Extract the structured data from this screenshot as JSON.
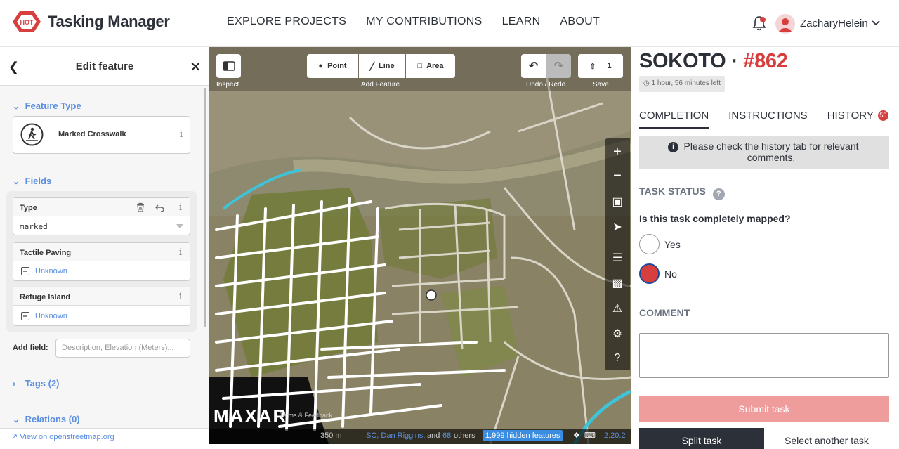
{
  "header": {
    "brand": "Tasking Manager",
    "logo_text": "HOT",
    "nav": [
      "EXPLORE PROJECTS",
      "MY CONTRIBUTIONS",
      "LEARN",
      "ABOUT"
    ],
    "username": "ZacharyHelein"
  },
  "editor": {
    "title": "Edit feature",
    "feature_type_heading": "Feature Type",
    "feature_type": "Marked Crosswalk",
    "fields_heading": "Fields",
    "fields": [
      {
        "label": "Type",
        "value": "marked"
      },
      {
        "label": "Tactile Paving",
        "value": "Unknown"
      },
      {
        "label": "Refuge Island",
        "value": "Unknown"
      }
    ],
    "info_glyph": "i",
    "add_field_label": "Add field:",
    "add_field_placeholder": "Description, Elevation (Meters)...",
    "tags_heading": "Tags (2)",
    "relations_heading": "Relations (0)",
    "osm_link": "View on openstreetmap.org"
  },
  "map": {
    "toolbar": {
      "inspect": "Inspect",
      "point": "Point",
      "line": "Line",
      "area": "Area",
      "add_feature": "Add Feature",
      "undo_redo": "Undo / Redo",
      "save_count": "1",
      "save": "Save"
    },
    "footer": {
      "scale": "350 m",
      "attribution": "Terms & Feedback",
      "contributors_a": "SC, Dan Riggins,",
      "contributors_and": "and",
      "contributors_count": "68",
      "contributors_b": "others",
      "hidden_features": "1,999 hidden features",
      "version": "2.20.2"
    },
    "watermark": "MAXAR",
    "colors": {
      "road": "#ffffff",
      "water": "#3fc3d8",
      "area": "#b5b83a"
    }
  },
  "task": {
    "project": "SOKOTO",
    "separator": "·",
    "task_number": "#862",
    "time_left": "1 hour, 56 minutes left",
    "tabs": [
      "COMPLETION",
      "INSTRUCTIONS",
      "HISTORY"
    ],
    "history_count": "55",
    "notice": "Please check the history tab for relevant comments.",
    "status_heading": "TASK STATUS",
    "question": "Is this task completely mapped?",
    "options": [
      "Yes",
      "No"
    ],
    "selected": "No",
    "comment_heading": "COMMENT",
    "submit": "Submit task",
    "split": "Split task",
    "select_another": "Select another task",
    "colors": {
      "accent": "#d73f3f",
      "submit_disabled": "#ef9c9c"
    }
  }
}
